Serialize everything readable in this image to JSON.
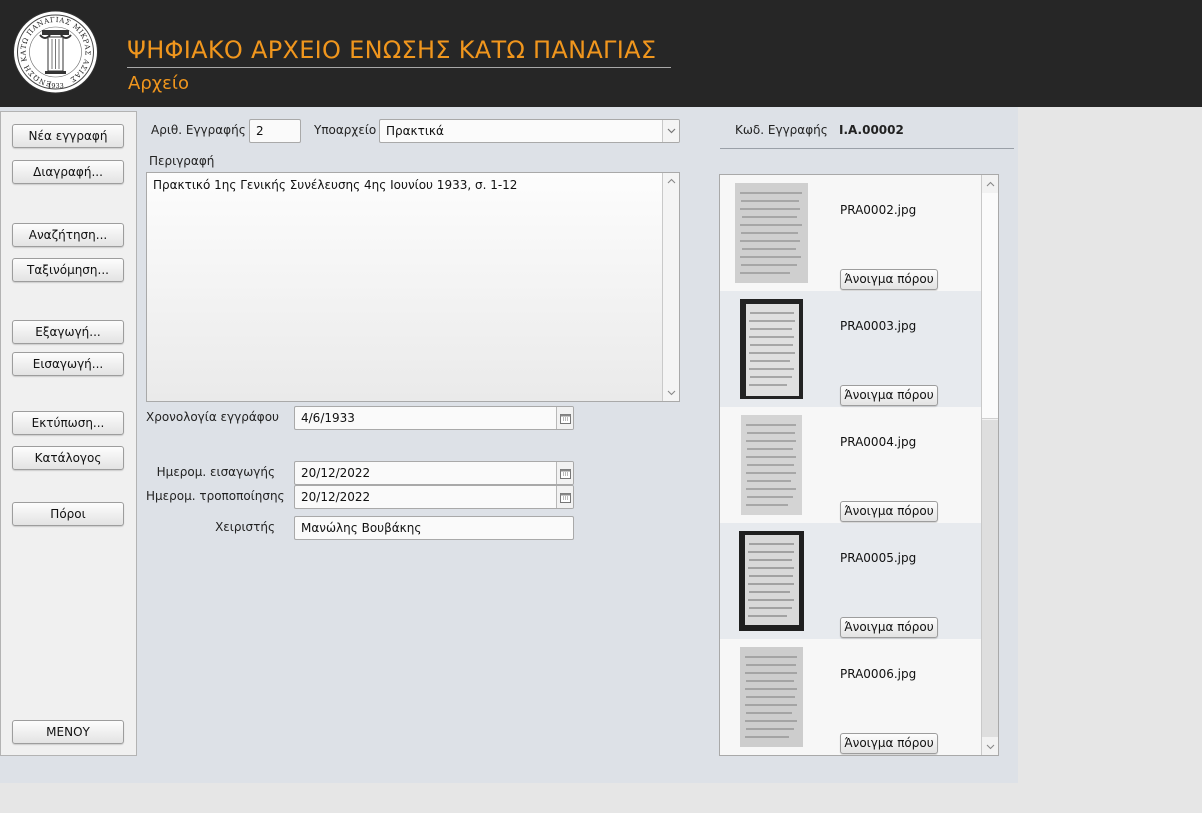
{
  "header": {
    "title": "ΨΗΦΙΑΚΟ ΑΡΧΕΙΟ ΕΝΩΣΗΣ ΚΑΤΩ ΠΑΝΑΓΙΑΣ",
    "subtitle": "Αρχείο",
    "logo_ring_text": "ΕΝΩΣΗ ΚΑΤΩ ΠΑΝΑΓΙΑΣ ΜΙΚΡΑΣ ΑΣΙΑΣ",
    "logo_year": "1933"
  },
  "sidebar": {
    "new_record": "Νέα εγγραφή",
    "delete": "Διαγραφή...",
    "search": "Αναζήτηση...",
    "sort": "Ταξινόμηση...",
    "export": "Εξαγωγή...",
    "import": "Εισαγωγή...",
    "print": "Εκτύπωση...",
    "catalog": "Κατάλογος",
    "resources": "Πόροι",
    "menu": "ΜΕΝΟΥ"
  },
  "record": {
    "number_label": "Αριθ. Εγγραφής",
    "number_value": "2",
    "subarchive_label": "Υποαρχείο",
    "subarchive_value": "Πρακτικά",
    "code_label": "Κωδ. Εγγραφής",
    "code_value": "I.A.00002",
    "description_label": "Περιγραφή",
    "description_value": "Πρακτικό 1ης Γενικής Συνέλευσης 4ης Ιουνίου 1933, σ. 1-12",
    "doc_date_label": "Χρονολογία εγγράφου",
    "doc_date_value": "4/6/1933",
    "entry_date_label": "Ημερομ. εισαγωγής",
    "entry_date_value": "20/12/2022",
    "modified_date_label": "Ημερομ. τροποποίησης",
    "modified_date_value": "20/12/2022",
    "handler_label": "Χειριστής",
    "handler_value": "Μανώλης Βουβάκης"
  },
  "resources": {
    "open_label": "Άνοιγμα πόρου",
    "items": [
      {
        "filename": "PRA0002.jpg"
      },
      {
        "filename": "PRA0003.jpg"
      },
      {
        "filename": "PRA0004.jpg"
      },
      {
        "filename": "PRA0005.jpg"
      },
      {
        "filename": "PRA0006.jpg"
      }
    ]
  },
  "colors": {
    "header_bg": "#262626",
    "title_accent": "#f0961d",
    "form_bg": "#dde1e7"
  },
  "icons": [
    "logo-emblem",
    "calendar-icon",
    "chevron-down-icon",
    "scroll-up-icon",
    "scroll-down-icon"
  ]
}
